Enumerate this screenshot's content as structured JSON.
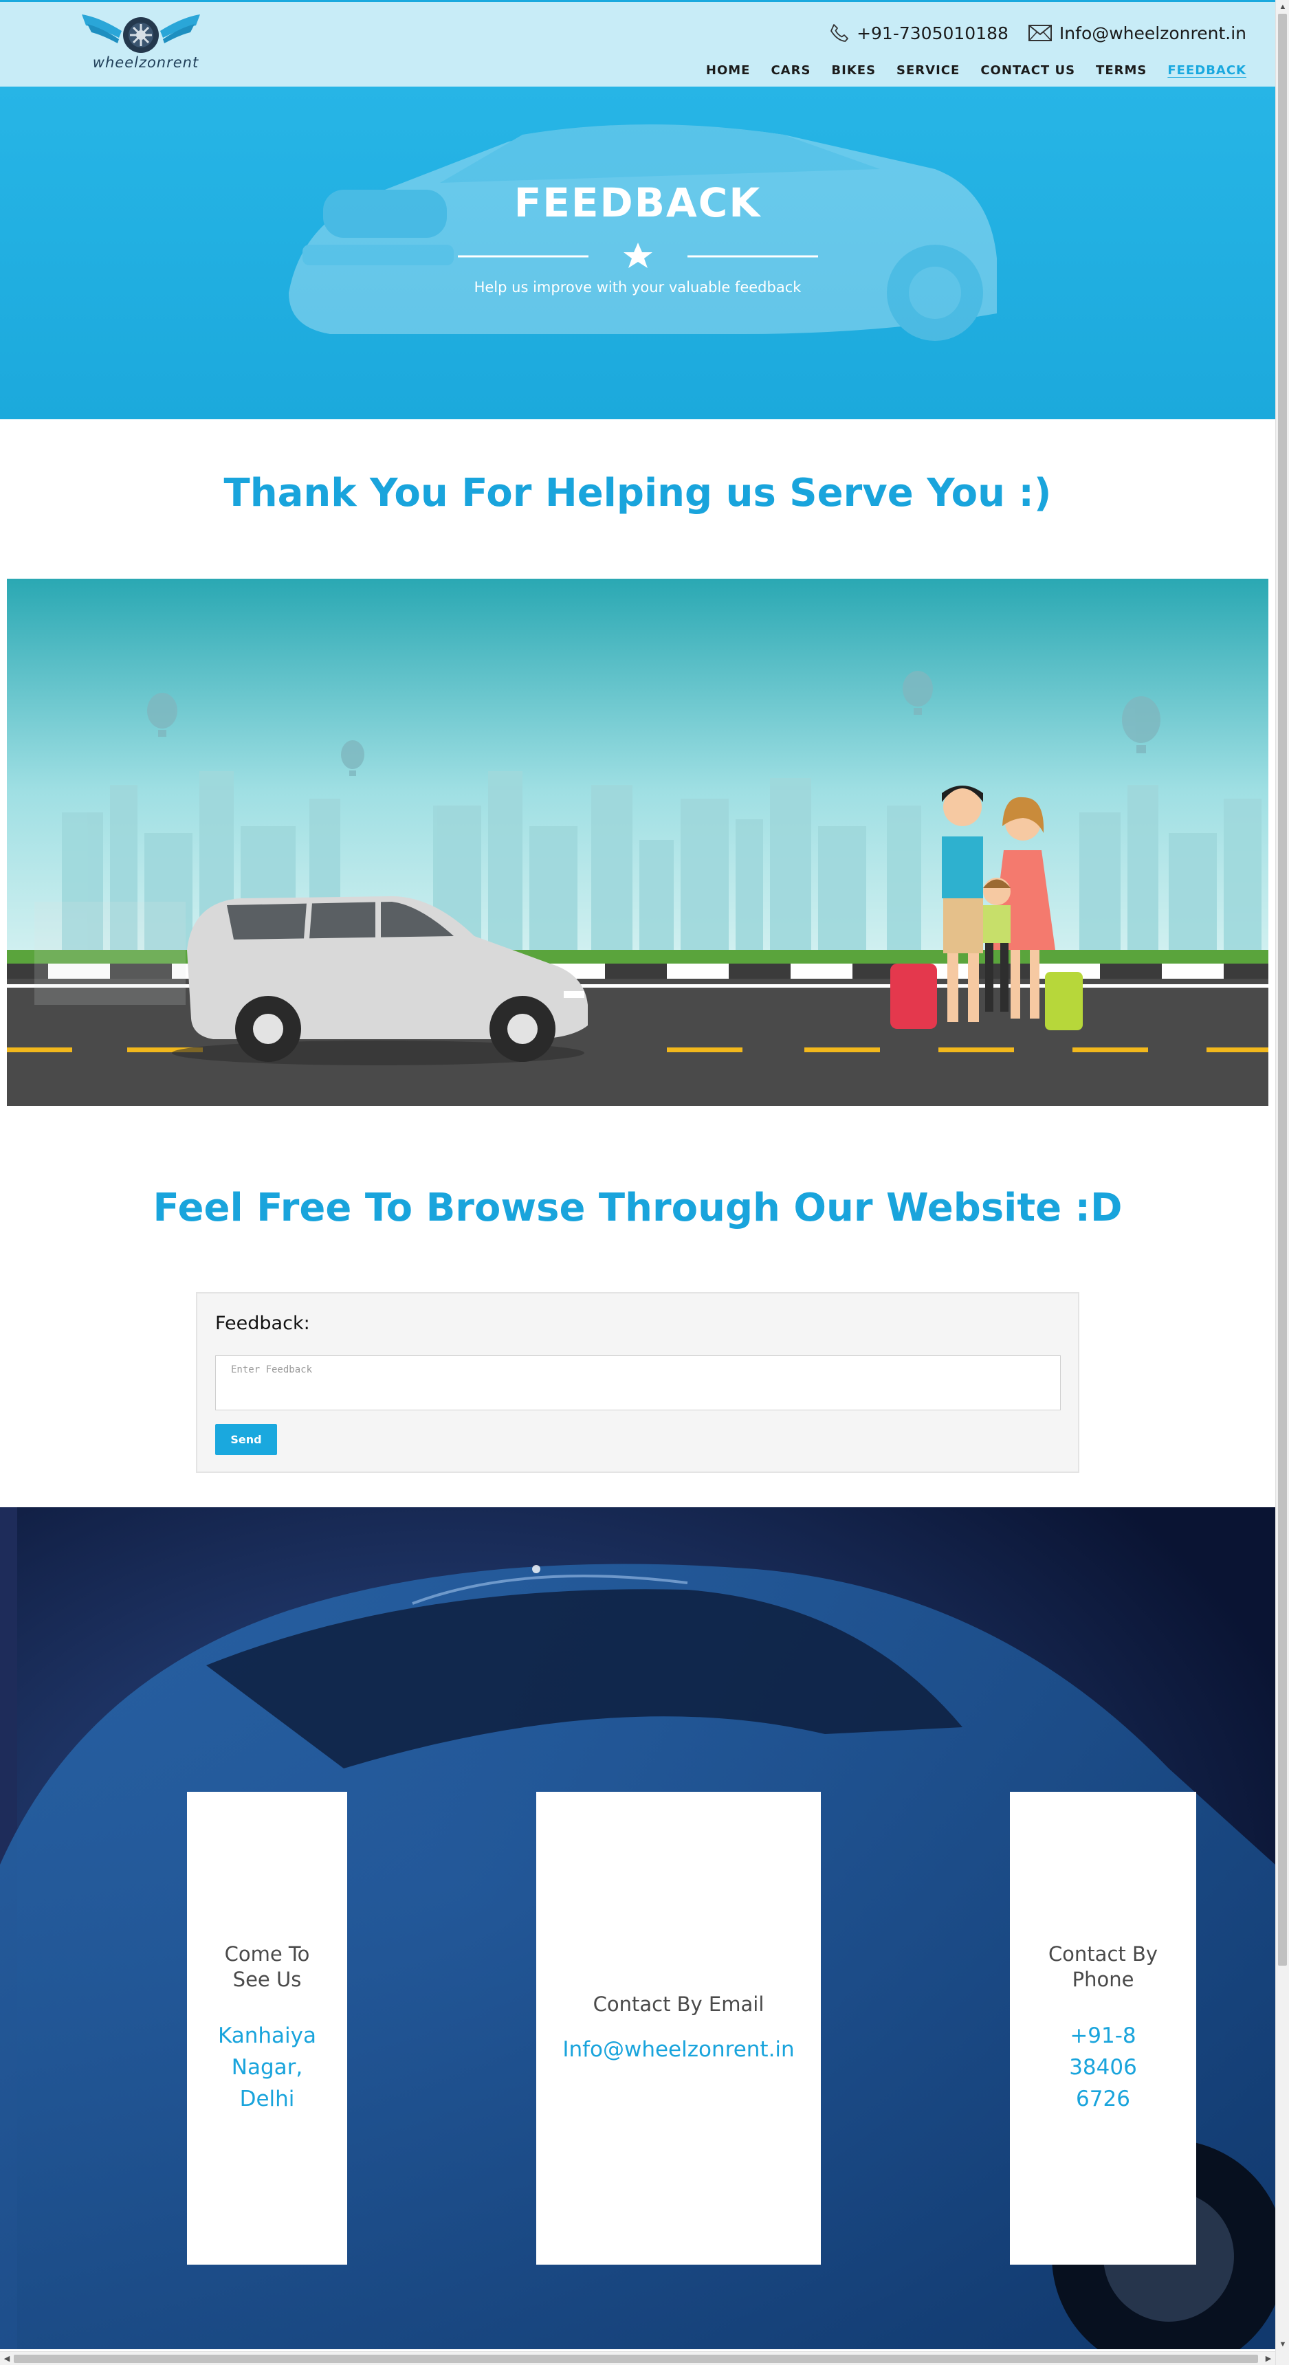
{
  "header": {
    "logo_text": "wheelzonrent",
    "phone": "+91-7305010188",
    "email": "Info@wheelzonrent.in",
    "nav": [
      {
        "label": "HOME"
      },
      {
        "label": "CARS"
      },
      {
        "label": "BIKES"
      },
      {
        "label": "SERVICE"
      },
      {
        "label": "CONTACT US"
      },
      {
        "label": "TERMS"
      },
      {
        "label": "FEEDBACK"
      }
    ],
    "active_nav": "FEEDBACK"
  },
  "hero": {
    "title": "FEEDBACK",
    "subtitle": "Help us improve with your valuable feedback",
    "divider_icon": "star-icon"
  },
  "main": {
    "heading1": "Thank You For Helping us Serve You :)",
    "heading2": "Feel Free To Browse Through Our Website :D"
  },
  "feedback_form": {
    "label": "Feedback:",
    "placeholder": "Enter Feedback",
    "value": "",
    "submit_label": "Send"
  },
  "contact_cards": [
    {
      "title": "Come To See Us",
      "value": "Kanhaiya Nagar, Delhi"
    },
    {
      "title": "Contact By Email",
      "value": "Info@wheelzonrent.in"
    },
    {
      "title": "Contact By Phone",
      "value": "+91-8384066726"
    }
  ],
  "colors": {
    "accent": "#19a4dc",
    "header_bg": "#c8ecf7",
    "hero_bg": "#1ca9dc",
    "footer_bg": "#0d1a3c"
  },
  "icons": [
    "phone-icon",
    "envelope-icon",
    "star-icon",
    "logo-wheel-icon"
  ]
}
